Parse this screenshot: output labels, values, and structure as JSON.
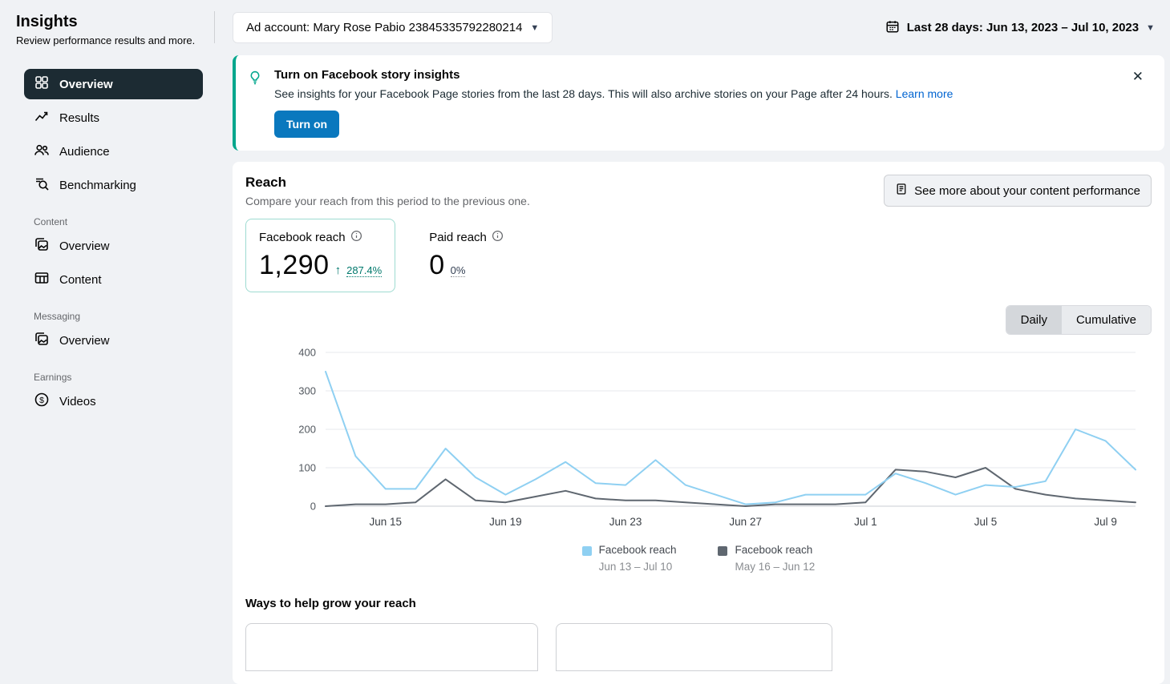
{
  "sidebar": {
    "title": "Insights",
    "subtitle": "Review performance results and more.",
    "nav": [
      {
        "label": "Overview"
      },
      {
        "label": "Results"
      },
      {
        "label": "Audience"
      },
      {
        "label": "Benchmarking"
      }
    ],
    "sections": [
      {
        "title": "Content",
        "items": [
          {
            "label": "Overview"
          },
          {
            "label": "Content"
          }
        ]
      },
      {
        "title": "Messaging",
        "items": [
          {
            "label": "Overview"
          }
        ]
      },
      {
        "title": "Earnings",
        "items": [
          {
            "label": "Videos"
          }
        ]
      }
    ]
  },
  "topbar": {
    "ad_account": "Ad account: Mary Rose Pabio 23845335792280214",
    "date_range": "Last 28 days: Jun 13, 2023 – Jul 10, 2023"
  },
  "banner": {
    "title": "Turn on Facebook story insights",
    "description": "See insights for your Facebook Page stories from the last 28 days. This will also archive stories on your Page after 24 hours.",
    "link": "Learn more",
    "button": "Turn on",
    "accent_color": "#00a68c"
  },
  "reach": {
    "title": "Reach",
    "subtitle": "Compare your reach from this period to the previous one.",
    "see_more_button": "See more about your content performance",
    "metrics": [
      {
        "label": "Facebook reach",
        "value": "1,290",
        "delta": "287.4%",
        "trend": "up"
      },
      {
        "label": "Paid reach",
        "value": "0",
        "delta": "0%",
        "trend": "flat"
      }
    ],
    "toggle": {
      "daily": "Daily",
      "cumulative": "Cumulative",
      "selected": "Daily"
    }
  },
  "grow": {
    "title": "Ways to help grow your reach"
  },
  "chart_data": {
    "type": "line",
    "title": "Reach",
    "x": [
      "Jun 13",
      "Jun 14",
      "Jun 15",
      "Jun 16",
      "Jun 17",
      "Jun 18",
      "Jun 19",
      "Jun 20",
      "Jun 21",
      "Jun 22",
      "Jun 23",
      "Jun 24",
      "Jun 25",
      "Jun 26",
      "Jun 27",
      "Jun 28",
      "Jun 29",
      "Jun 30",
      "Jul 1",
      "Jul 2",
      "Jul 3",
      "Jul 4",
      "Jul 5",
      "Jul 6",
      "Jul 7",
      "Jul 8",
      "Jul 9",
      "Jul 10"
    ],
    "x_tick_labels": [
      "Jun 15",
      "Jun 19",
      "Jun 23",
      "Jun 27",
      "Jul 1",
      "Jul 5",
      "Jul 9"
    ],
    "x_tick_indices": [
      2,
      6,
      10,
      14,
      18,
      22,
      26
    ],
    "ylim": [
      0,
      400
    ],
    "y_ticks": [
      0,
      100,
      200,
      300,
      400
    ],
    "grid": true,
    "legend_position": "bottom",
    "series": [
      {
        "name": "Facebook reach",
        "period": "Jun 13 – Jul 10",
        "color": "#8fd0f2",
        "values": [
          350,
          130,
          45,
          45,
          150,
          75,
          30,
          70,
          115,
          60,
          55,
          120,
          55,
          30,
          5,
          10,
          30,
          30,
          30,
          85,
          60,
          30,
          55,
          50,
          65,
          200,
          170,
          95
        ]
      },
      {
        "name": "Facebook reach",
        "period": "May 16 – Jun 12",
        "color": "#5f6770",
        "values": [
          0,
          5,
          5,
          10,
          70,
          15,
          10,
          25,
          40,
          20,
          15,
          15,
          10,
          5,
          0,
          5,
          5,
          5,
          10,
          95,
          90,
          75,
          100,
          45,
          30,
          20,
          15,
          10
        ]
      }
    ]
  }
}
